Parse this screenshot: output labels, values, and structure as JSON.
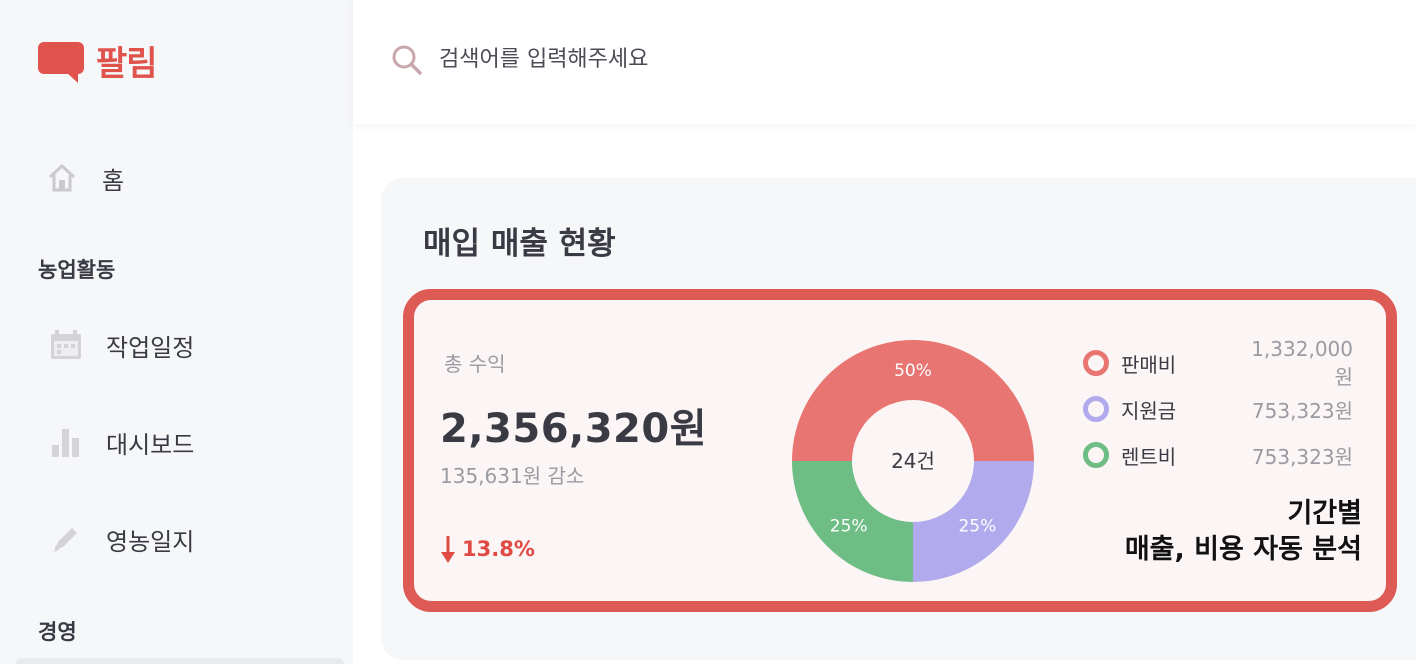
{
  "app": {
    "name": "팔림",
    "brand_color": "#e0524c"
  },
  "search": {
    "placeholder": "검색어를 입력해주세요"
  },
  "sidebar": {
    "home": {
      "label": "홈",
      "icon": "home-icon"
    },
    "sections": [
      {
        "title": "농업활동",
        "items": [
          {
            "label": "작업일정",
            "icon": "calendar-icon"
          },
          {
            "label": "대시보드",
            "icon": "bar-chart-icon"
          },
          {
            "label": "영농일지",
            "icon": "pencil-icon"
          }
        ]
      },
      {
        "title": "경영",
        "items": []
      }
    ]
  },
  "main": {
    "title": "매입 매출 현황",
    "summary": {
      "label": "총 수익",
      "total": "2,356,320원",
      "decrease": "135,631원 감소",
      "change": "13.8%",
      "change_direction": "down",
      "change_color": "#e04a44"
    },
    "donut_center": "24건",
    "highlight": {
      "line1": "기간별",
      "line2": "매출, 비용 자동 분석"
    }
  },
  "chart_data": {
    "type": "pie",
    "center_label": "24건",
    "slices": [
      {
        "name": "판매비",
        "percent": 50,
        "label": "50%",
        "amount": "1,332,000원",
        "color": "#e87572"
      },
      {
        "name": "지원금",
        "percent": 25,
        "label": "25%",
        "amount": "753,323원",
        "color": "#b1aaec"
      },
      {
        "name": "렌트비",
        "percent": 25,
        "label": "25%",
        "amount": "753,323원",
        "color": "#6dbd84"
      }
    ]
  }
}
